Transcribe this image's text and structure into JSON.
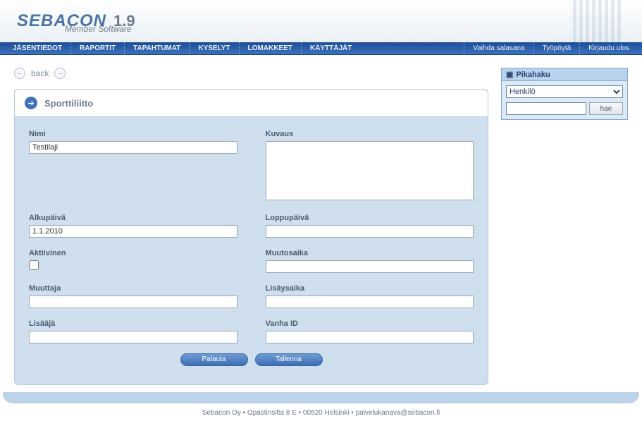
{
  "header": {
    "brand": "SEBACON",
    "version": "1.9",
    "subtitle": "Member Software"
  },
  "nav": {
    "left": [
      "JÄSENTIEDOT",
      "RAPORTIT",
      "TAPAHTUMAT",
      "KYSELYT",
      "LOMAKKEET",
      "KÄYTTÄJÄT"
    ],
    "right": [
      "Vaihda salasana",
      "Työpöytä",
      "Kirjaudu ulos"
    ]
  },
  "backbar": {
    "label": "back"
  },
  "panel": {
    "title": "Sporttiliitto"
  },
  "form": {
    "nimi": {
      "label": "Nimi",
      "value": "Testilaji"
    },
    "kuvaus": {
      "label": "Kuvaus",
      "value": ""
    },
    "alkupaiva": {
      "label": "Alkupäivä",
      "value": "1.1.2010"
    },
    "loppupaiva": {
      "label": "Loppupäivä",
      "value": ""
    },
    "aktiivinen": {
      "label": "Aktiivinen",
      "checked": false
    },
    "muutosaika": {
      "label": "Muutosaika",
      "value": ""
    },
    "muuttaja": {
      "label": "Muuttaja",
      "value": ""
    },
    "lisaysaika": {
      "label": "Lisäysaika",
      "value": ""
    },
    "lisaaja": {
      "label": "Lisääjä",
      "value": ""
    },
    "vanhaid": {
      "label": "Vanha ID",
      "value": ""
    }
  },
  "buttons": {
    "reset": "Palauta",
    "save": "Tallenna"
  },
  "quicksearch": {
    "title": "Pikahaku",
    "type_selected": "Henkilö",
    "search_value": "",
    "search_button": "hae"
  },
  "footer": "Sebacon Oy • Opastinsilta 8 E • 00520 Helsinki • palvelukanava@sebacon.fi"
}
